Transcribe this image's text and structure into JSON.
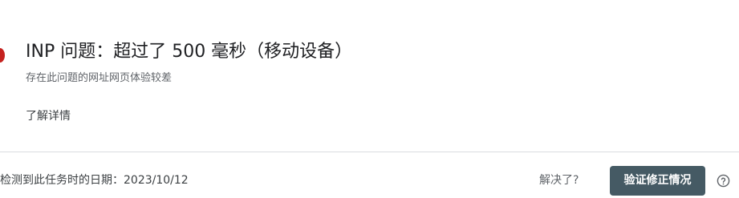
{
  "issue": {
    "title": "INP 问题：超过了 500 毫秒（移动设备）",
    "subtitle": "存在此问题的网址网页体验较差",
    "status_color": "#c5221f"
  },
  "learn_more_label": "了解详情",
  "footer": {
    "detected_text": "检测到此任务时的日期：2023/10/12",
    "resolved_label": "解决了?",
    "validate_button_label": "验证修正情况",
    "help_icon": "help-circle-icon"
  }
}
